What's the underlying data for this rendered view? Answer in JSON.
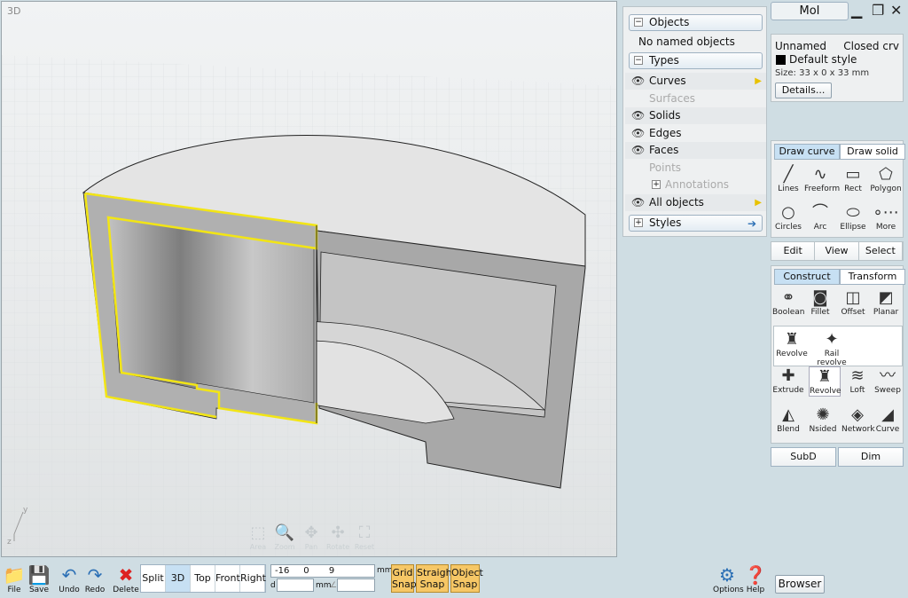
{
  "viewport": {
    "label": "3D",
    "tools": [
      {
        "icon": "zoom-area-icon",
        "label": "Area",
        "glyph": "⬚"
      },
      {
        "icon": "zoom-icon",
        "label": "Zoom",
        "glyph": "🔍"
      },
      {
        "icon": "pan-icon",
        "label": "Pan",
        "glyph": "✥"
      },
      {
        "icon": "rotate-icon",
        "label": "Rotate",
        "glyph": "✣"
      },
      {
        "icon": "reset-icon",
        "label": "Reset",
        "glyph": "⛶"
      }
    ],
    "axis_y": "y",
    "axis_z": "z"
  },
  "scene": {
    "objects_label": "Objects",
    "no_named": "No named objects",
    "types_label": "Types",
    "types": [
      {
        "label": "Curves",
        "visible": true,
        "arrow": true
      },
      {
        "label": "Surfaces",
        "visible": false,
        "arrow": false
      },
      {
        "label": "Solids",
        "visible": true,
        "arrow": false
      },
      {
        "label": "Edges",
        "visible": true,
        "arrow": false
      },
      {
        "label": "Faces",
        "visible": true,
        "arrow": false
      },
      {
        "label": "Points",
        "visible": false,
        "arrow": false
      },
      {
        "label": "Annotations",
        "visible": false,
        "arrow": false
      },
      {
        "label": "All objects",
        "visible": true,
        "arrow": true
      }
    ],
    "styles_label": "Styles"
  },
  "title": "MoI",
  "props": {
    "name": "Unnamed",
    "type": "Closed crv",
    "style": "Default style",
    "style_color": "#000000",
    "size": "Size: 33 x 0 x 33 mm",
    "details": "Details..."
  },
  "draw": {
    "tabs": [
      "Draw curve",
      "Draw solid"
    ],
    "tools": [
      {
        "label": "Lines",
        "icon": "lines-icon",
        "glyph": "╱"
      },
      {
        "label": "Freeform",
        "icon": "freeform-icon",
        "glyph": "∿"
      },
      {
        "label": "Rect",
        "icon": "rect-icon",
        "glyph": "▭"
      },
      {
        "label": "Polygon",
        "icon": "polygon-icon",
        "glyph": "⬠"
      },
      {
        "label": "Circles",
        "icon": "circles-icon",
        "glyph": "○"
      },
      {
        "label": "Arc",
        "icon": "arc-icon",
        "glyph": "⌒"
      },
      {
        "label": "Ellipse",
        "icon": "ellipse-icon",
        "glyph": "⬭"
      },
      {
        "label": "More",
        "icon": "more-icon",
        "glyph": "∘⋯"
      }
    ]
  },
  "evs": {
    "edit": "Edit",
    "view": "View",
    "select": "Select"
  },
  "construct": {
    "tabs": [
      "Construct",
      "Transform"
    ],
    "row1": [
      {
        "label": "Boolean",
        "icon": "boolean-icon",
        "glyph": "⚭"
      },
      {
        "label": "Fillet",
        "icon": "fillet-icon",
        "glyph": "◙"
      },
      {
        "label": "Offset",
        "icon": "offset-icon",
        "glyph": "◫"
      },
      {
        "label": "Planar",
        "icon": "planar-icon",
        "glyph": "◩"
      }
    ],
    "sub": [
      {
        "label": "Revolve",
        "icon": "revolve-icon",
        "glyph": "♜"
      },
      {
        "label": "Rail revolve",
        "icon": "rail-revolve-icon",
        "glyph": "✦"
      }
    ],
    "row2": [
      {
        "label": "Extrude",
        "icon": "extrude-icon",
        "glyph": "✚"
      },
      {
        "label": "Revolve",
        "icon": "revolve-icon",
        "glyph": "♜"
      },
      {
        "label": "Loft",
        "icon": "loft-icon",
        "glyph": "≋"
      },
      {
        "label": "Sweep",
        "icon": "sweep-icon",
        "glyph": "〰"
      }
    ],
    "row3": [
      {
        "label": "Blend",
        "icon": "blend-icon",
        "glyph": "◭"
      },
      {
        "label": "Nsided",
        "icon": "nsided-icon",
        "glyph": "✺"
      },
      {
        "label": "Network",
        "icon": "network-icon",
        "glyph": "◈"
      },
      {
        "label": "Curve",
        "icon": "curve-icon",
        "glyph": "◢"
      }
    ]
  },
  "subd": {
    "subd": "SubD",
    "dim": "Dim"
  },
  "bottom": {
    "file": "File",
    "save": "Save",
    "undo": "Undo",
    "redo": "Redo",
    "delete": "Delete",
    "views": [
      "Split",
      "3D",
      "Top",
      "Front",
      "Right"
    ],
    "coord_x": "-16",
    "coord_y": "0",
    "coord_z": "9",
    "unit": "mm",
    "d_label": "d",
    "d_value": "",
    "d_unit": "mm",
    "angle_value": "",
    "grid_snap": [
      "Grid",
      "Snap"
    ],
    "straight_snap": [
      "Straight",
      "Snap"
    ],
    "object_snap": [
      "Object",
      "Snap"
    ],
    "options": "Options",
    "help": "Help",
    "browser": "Browser"
  }
}
